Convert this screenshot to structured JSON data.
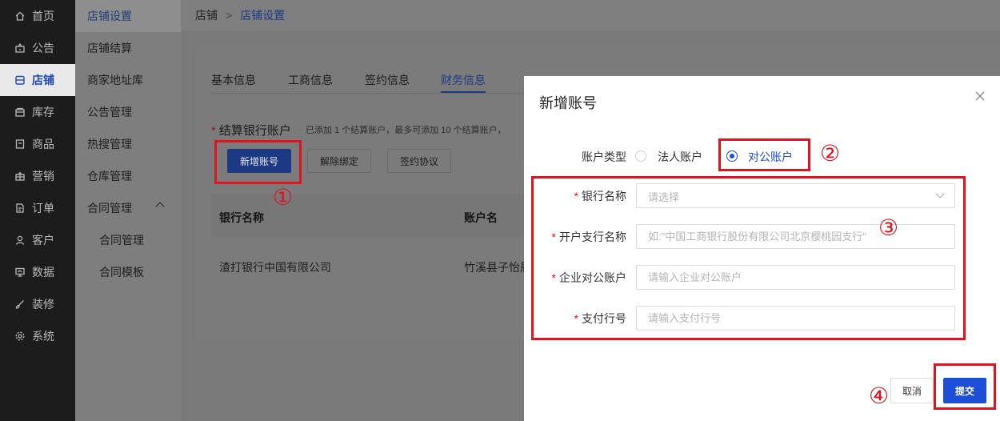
{
  "sidebar": {
    "items": [
      {
        "label": "首页",
        "icon": "home-icon"
      },
      {
        "label": "公告",
        "icon": "megaphone-icon"
      },
      {
        "label": "店铺",
        "icon": "shop-icon"
      },
      {
        "label": "库存",
        "icon": "box-icon"
      },
      {
        "label": "商品",
        "icon": "product-icon"
      },
      {
        "label": "营销",
        "icon": "gift-icon"
      },
      {
        "label": "订单",
        "icon": "order-icon"
      },
      {
        "label": "客户",
        "icon": "user-icon"
      },
      {
        "label": "数据",
        "icon": "chart-icon"
      },
      {
        "label": "装修",
        "icon": "brush-icon"
      },
      {
        "label": "系统",
        "icon": "gear-icon"
      }
    ],
    "active_index": 2
  },
  "submenu": {
    "items": [
      "店铺设置",
      "店铺结算",
      "商家地址库",
      "公告管理",
      "热搜管理",
      "仓库管理",
      "合同管理",
      "合同管理",
      "合同模板"
    ]
  },
  "breadcrumb": {
    "root": "店铺",
    "separator": ">",
    "current": "店铺设置"
  },
  "tabs": [
    "基本信息",
    "工商信息",
    "签约信息",
    "财务信息"
  ],
  "section": {
    "required_mark": "*",
    "title": "结算银行账户",
    "description": "已添加 1 个结算账户，最多可添加 10 个结算账户，"
  },
  "actions": {
    "add": "新增账号",
    "unbind": "解除绑定",
    "agreement": "签约协议"
  },
  "table": {
    "headers": [
      "银行名称",
      "账户名"
    ],
    "rows": [
      [
        "渣打银行中国有限公司",
        "竹溪县子怡辰"
      ]
    ]
  },
  "modal": {
    "title": "新增账号",
    "account_type_label": "账户类型",
    "account_types": [
      "法人账户",
      "对公账户"
    ],
    "selected_type": "对公账户",
    "fields": [
      {
        "label": "银行名称",
        "placeholder": "请选择",
        "required": true
      },
      {
        "label": "开户支行名称",
        "placeholder": "如:\"中国工商银行股份有限公司北京樱桃园支行\"",
        "required": true
      },
      {
        "label": "企业对公账户",
        "placeholder": "请输入企业对公账户",
        "required": true
      },
      {
        "label": "支付行号",
        "placeholder": "请输入支付行号",
        "required": true
      }
    ],
    "cancel": "取消",
    "submit": "提交"
  },
  "annotations": {
    "step1": "①",
    "step2": "②",
    "step3": "③",
    "step4": "④",
    "color": "#e0141e"
  },
  "colors": {
    "primary": "#1d4ed8",
    "sidebar_bg": "#1c1c1c",
    "overlay": "#7b7b7b"
  }
}
